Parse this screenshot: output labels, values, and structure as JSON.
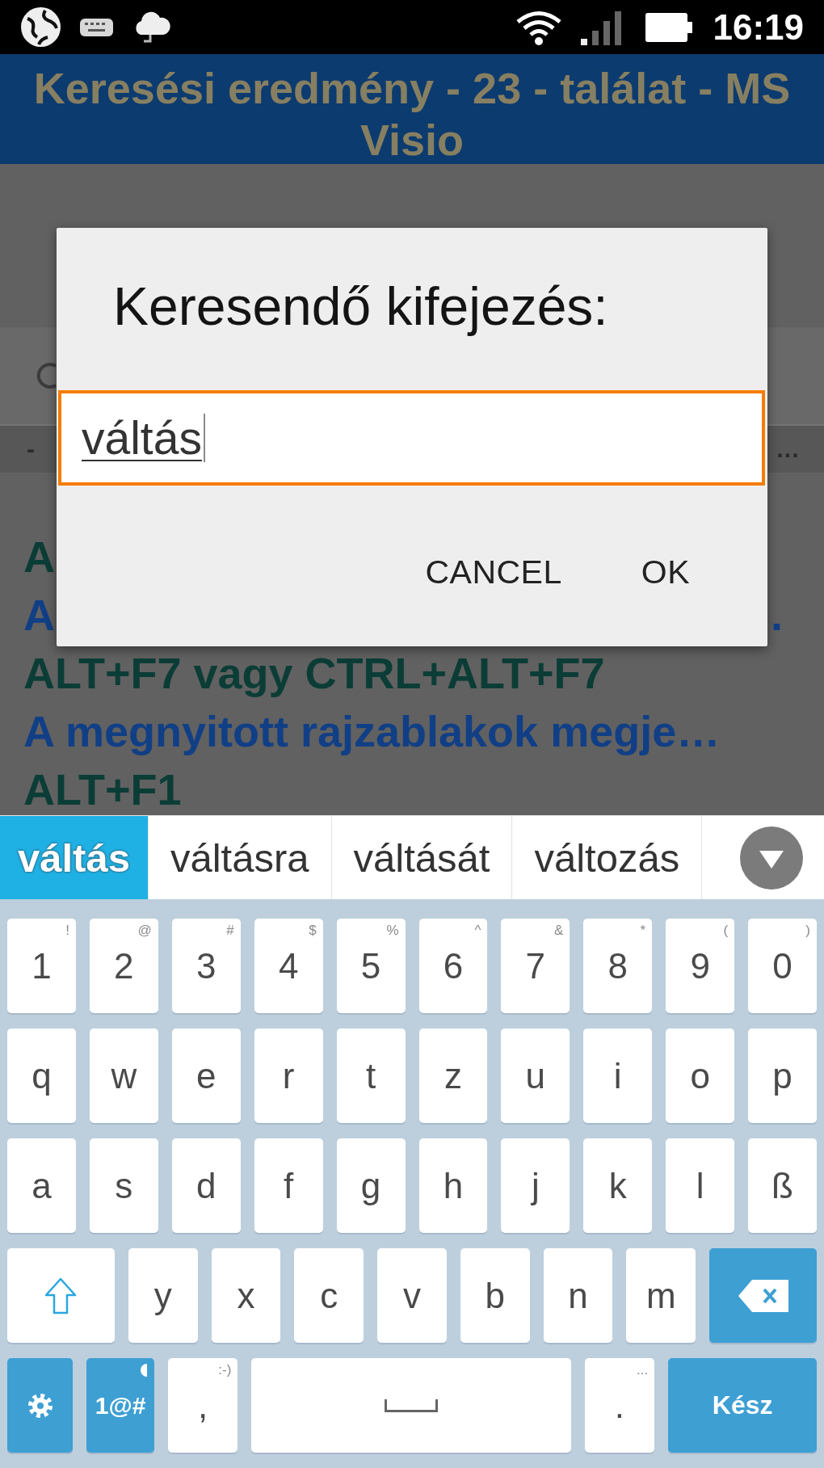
{
  "status_bar": {
    "time": "16:19"
  },
  "title_bar": {
    "title": "Keresési eredmény - 23 - találat - MS Visio"
  },
  "results_list": {
    "header": {
      "start": "-",
      "end": "…"
    },
    "items": [
      {
        "kind": "shortcut",
        "text": "A"
      },
      {
        "kind": "description",
        "text": "A",
        "end": "."
      },
      {
        "kind": "shortcut",
        "text": "ALT+F7 vagy CTRL+ALT+F7"
      },
      {
        "kind": "description",
        "text": "A megnyitott rajzablakok megje…"
      },
      {
        "kind": "shortcut",
        "text": "ALT+F1"
      }
    ]
  },
  "dialog": {
    "title": "Keresendő kifejezés:",
    "input": {
      "value": "váltás",
      "focused": true,
      "composing": true
    },
    "buttons": [
      "CANCEL",
      "OK"
    ]
  },
  "suggestions": [
    {
      "text": "váltás",
      "selected": true
    },
    {
      "text": "váltásra",
      "selected": false
    },
    {
      "text": "váltását",
      "selected": false
    },
    {
      "text": "változás",
      "selected": false
    }
  ],
  "keyboard": {
    "rows": [
      {
        "keys": [
          {
            "kind": "char",
            "label": "1",
            "hint": "!"
          },
          {
            "kind": "char",
            "label": "2",
            "hint": "@"
          },
          {
            "kind": "char",
            "label": "3",
            "hint": "#"
          },
          {
            "kind": "char",
            "label": "4",
            "hint": "$"
          },
          {
            "kind": "char",
            "label": "5",
            "hint": "%"
          },
          {
            "kind": "char",
            "label": "6",
            "hint": "^"
          },
          {
            "kind": "char",
            "label": "7",
            "hint": "&"
          },
          {
            "kind": "char",
            "label": "8",
            "hint": "*"
          },
          {
            "kind": "char",
            "label": "9",
            "hint": "("
          },
          {
            "kind": "char",
            "label": "0",
            "hint": ")"
          }
        ]
      },
      {
        "keys": [
          {
            "kind": "char",
            "label": "q"
          },
          {
            "kind": "char",
            "label": "w"
          },
          {
            "kind": "char",
            "label": "e"
          },
          {
            "kind": "char",
            "label": "r"
          },
          {
            "kind": "char",
            "label": "t"
          },
          {
            "kind": "char",
            "label": "z"
          },
          {
            "kind": "char",
            "label": "u"
          },
          {
            "kind": "char",
            "label": "i"
          },
          {
            "kind": "char",
            "label": "o"
          },
          {
            "kind": "char",
            "label": "p"
          }
        ]
      },
      {
        "keys": [
          {
            "kind": "char",
            "label": "a"
          },
          {
            "kind": "char",
            "label": "s"
          },
          {
            "kind": "char",
            "label": "d"
          },
          {
            "kind": "char",
            "label": "f"
          },
          {
            "kind": "char",
            "label": "g"
          },
          {
            "kind": "char",
            "label": "h"
          },
          {
            "kind": "char",
            "label": "j"
          },
          {
            "kind": "char",
            "label": "k"
          },
          {
            "kind": "char",
            "label": "l"
          },
          {
            "kind": "char",
            "label": "ß"
          }
        ]
      },
      {
        "keys": [
          {
            "kind": "shift"
          },
          {
            "kind": "char",
            "label": "y"
          },
          {
            "kind": "char",
            "label": "x"
          },
          {
            "kind": "char",
            "label": "c"
          },
          {
            "kind": "char",
            "label": "v"
          },
          {
            "kind": "char",
            "label": "b"
          },
          {
            "kind": "char",
            "label": "n"
          },
          {
            "kind": "char",
            "label": "m"
          },
          {
            "kind": "backspace"
          }
        ]
      },
      {
        "keys": [
          {
            "kind": "settings"
          },
          {
            "kind": "symbols",
            "label": "1@#"
          },
          {
            "kind": "char",
            "label": ",",
            "hint": ":-)"
          },
          {
            "kind": "space"
          },
          {
            "kind": "char",
            "label": ".",
            "hint": "..."
          },
          {
            "kind": "action",
            "label": "Kész"
          }
        ]
      }
    ]
  }
}
